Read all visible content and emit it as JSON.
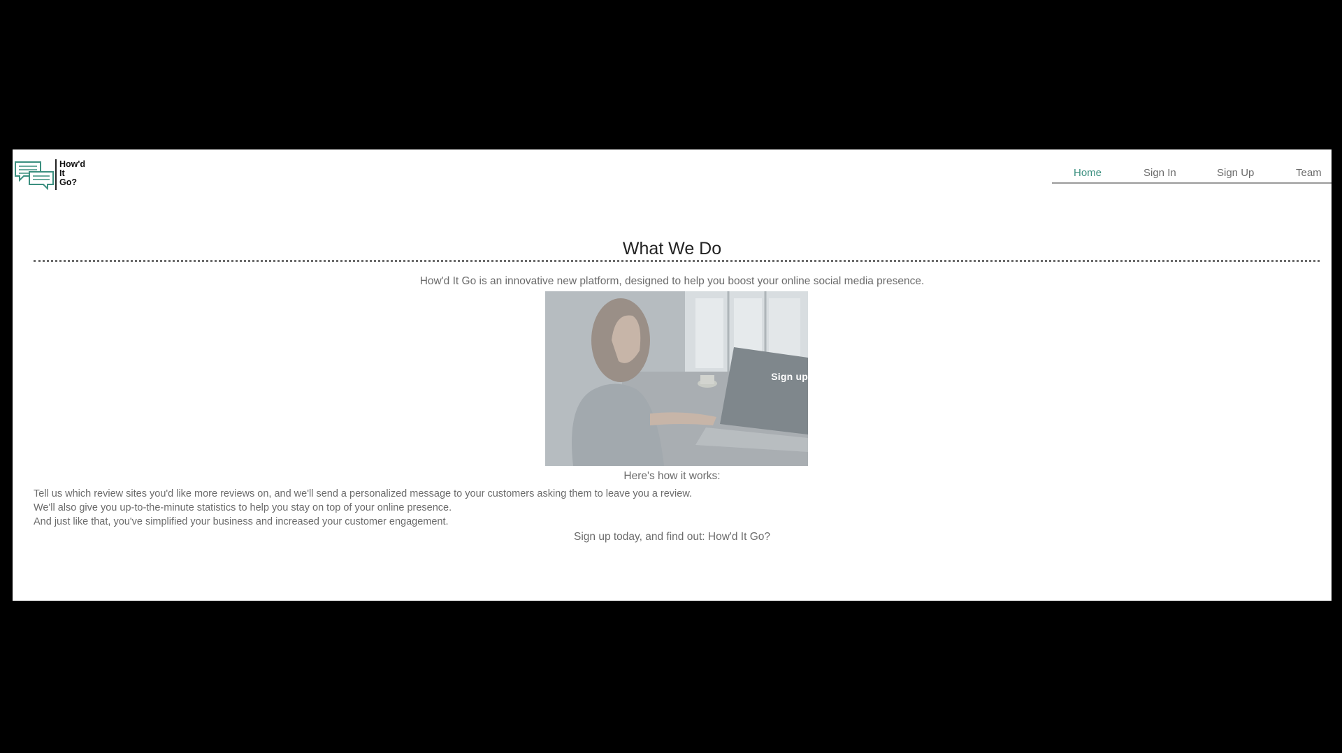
{
  "brand": {
    "logo_lines": [
      "How'd",
      "It",
      "Go?"
    ],
    "accent_color": "#3b8f7f"
  },
  "nav": {
    "items": [
      {
        "label": "Home",
        "active": true
      },
      {
        "label": "Sign In",
        "active": false
      },
      {
        "label": "Sign Up",
        "active": false
      },
      {
        "label": "Team",
        "active": false
      }
    ]
  },
  "main": {
    "title": "What We Do",
    "intro": "How'd It Go is an innovative new platform, designed to help you boost your online social media presence.",
    "hero": {
      "cta_label": "Sign up",
      "image_subject": "woman-working-on-laptop"
    },
    "how_heading": "Here's how it works:",
    "steps": [
      "Tell us which review sites you'd like more reviews on, and we'll send a personalized message to your customers asking them to leave you a review.",
      "We'll also give you up-to-the-minute statistics to help you stay on top of your online presence.",
      "And just like that, you've simplified your business and increased your customer engagement."
    ],
    "closing": "Sign up today, and find out: How'd It Go?"
  }
}
